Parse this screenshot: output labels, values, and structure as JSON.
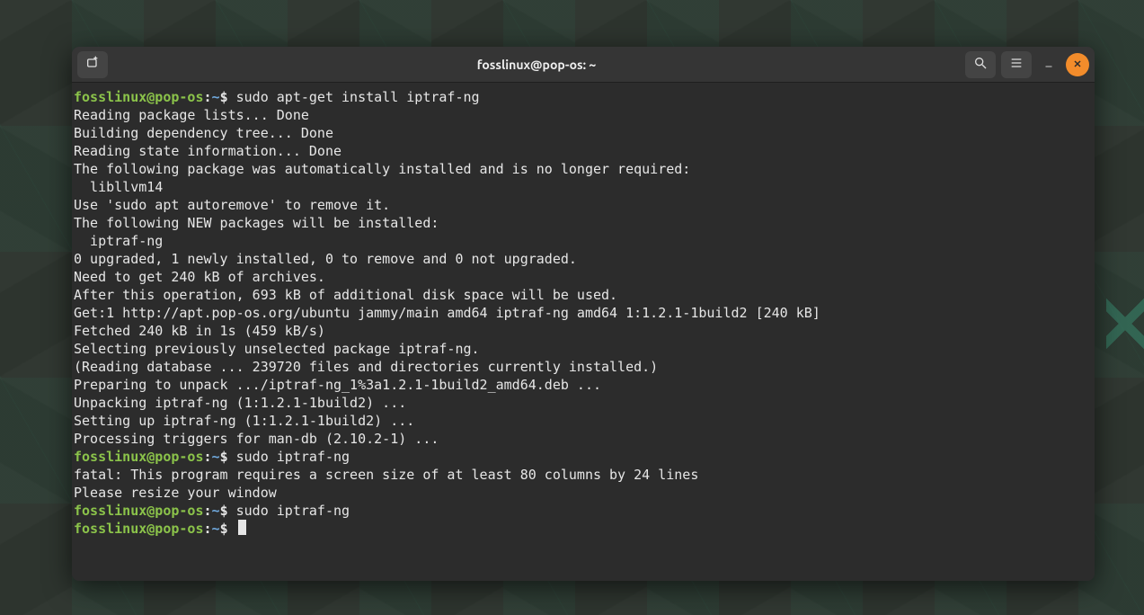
{
  "window": {
    "title": "fosslinux@pop-os: ~"
  },
  "prompt": {
    "user_host": "fosslinux@pop-os",
    "sep": ":",
    "cwd": "~",
    "symbol": "$"
  },
  "commands": {
    "c1": "sudo apt-get install iptraf-ng",
    "c2": "sudo iptraf-ng",
    "c3": "sudo iptraf-ng",
    "c4": ""
  },
  "output": {
    "l01": "Reading package lists... Done",
    "l02": "Building dependency tree... Done",
    "l03": "Reading state information... Done",
    "l04": "The following package was automatically installed and is no longer required:",
    "l05": "  libllvm14",
    "l06": "Use 'sudo apt autoremove' to remove it.",
    "l07": "The following NEW packages will be installed:",
    "l08": "  iptraf-ng",
    "l09": "0 upgraded, 1 newly installed, 0 to remove and 0 not upgraded.",
    "l10": "Need to get 240 kB of archives.",
    "l11": "After this operation, 693 kB of additional disk space will be used.",
    "l12": "Get:1 http://apt.pop-os.org/ubuntu jammy/main amd64 iptraf-ng amd64 1:1.2.1-1build2 [240 kB]",
    "l13": "Fetched 240 kB in 1s (459 kB/s)",
    "l14": "Selecting previously unselected package iptraf-ng.",
    "l15": "(Reading database ... 239720 files and directories currently installed.)",
    "l16": "Preparing to unpack .../iptraf-ng_1%3a1.2.1-1build2_amd64.deb ...",
    "l17": "Unpacking iptraf-ng (1:1.2.1-1build2) ...",
    "l18": "Setting up iptraf-ng (1:1.2.1-1build2) ...",
    "l19": "Processing triggers for man-db (2.10.2-1) ...",
    "l20": "fatal: This program requires a screen size of at least 80 columns by 24 lines",
    "l21": "Please resize your window"
  },
  "icons": {
    "new_tab": "new-tab-icon",
    "search": "search-icon",
    "menu": "hamburger-menu-icon",
    "minimize": "minimize-icon",
    "close": "close-icon"
  }
}
